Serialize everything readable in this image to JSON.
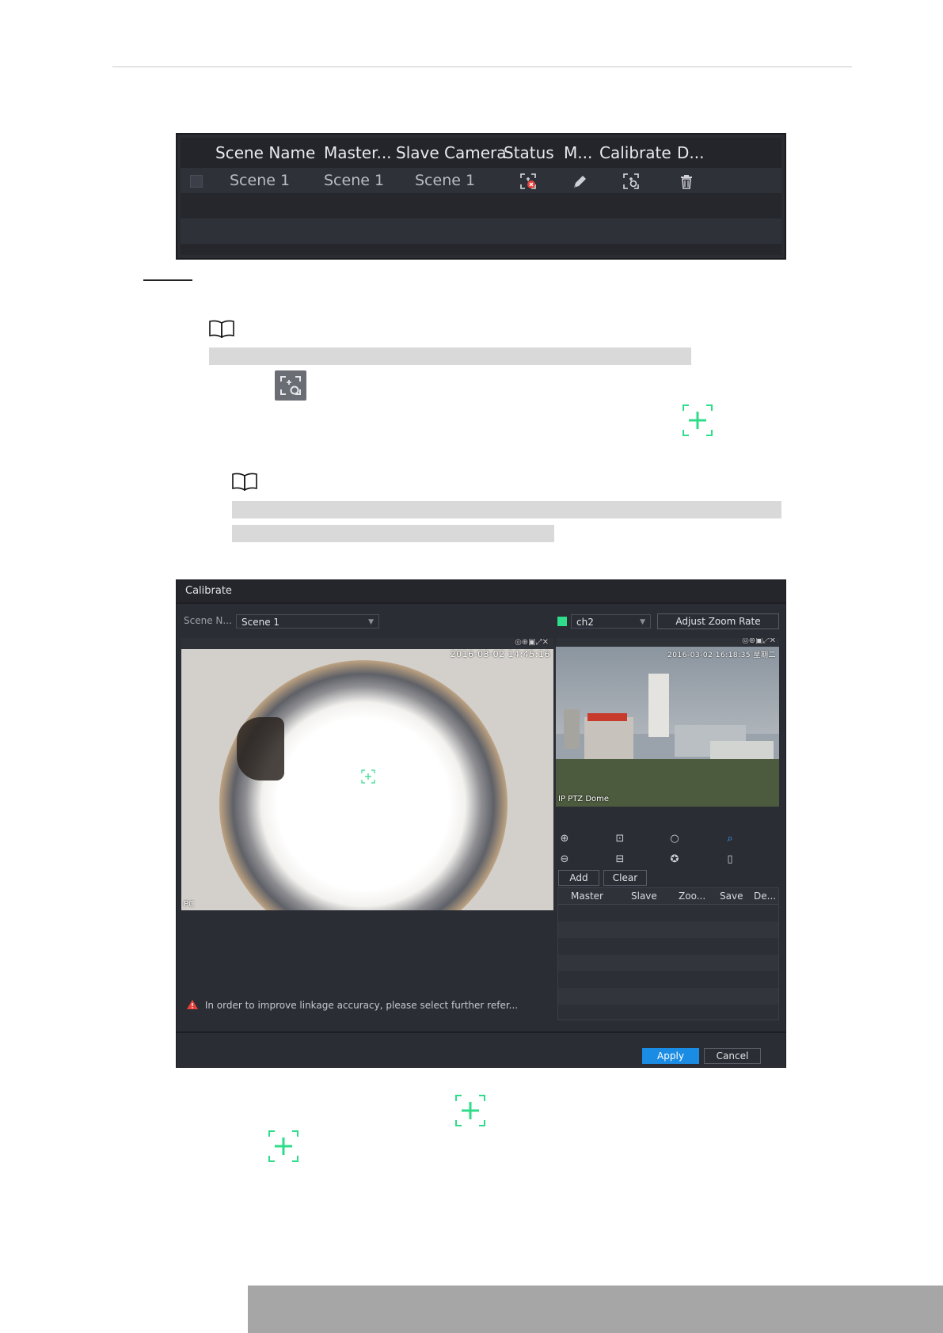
{
  "scene_table": {
    "headers": [
      "Scene Name",
      "Master...",
      "Slave Camera",
      "Status",
      "M...",
      "Calibrate",
      "D..."
    ],
    "rows": [
      {
        "scene_name": "Scene 1",
        "master": "Scene 1",
        "slave": "Scene 1"
      }
    ]
  },
  "dialog": {
    "title": "Calibrate",
    "scene_label": "Scene N...",
    "scene_value": "Scene 1",
    "channel_value": "ch2",
    "adjust_zoom_label": "Adjust Zoom Rate",
    "master_timestamp": "2016-03-02 14:45:16",
    "master_osd": "PC",
    "slave_timestamp": "2016-03-02 16:18:35 星期二",
    "slave_osd": "IP PTZ Dome",
    "add_label": "Add",
    "clear_label": "Clear",
    "table_headers": [
      "Master",
      "Slave",
      "Zoo...",
      "Save",
      "De..."
    ],
    "warning": "In order to improve linkage accuracy, please select further refer...",
    "apply_label": "Apply",
    "cancel_label": "Cancel"
  },
  "colors": {
    "accent_green": "#2fdc8a",
    "apply_blue": "#1b8ce3",
    "warning_red": "#e8413a"
  }
}
